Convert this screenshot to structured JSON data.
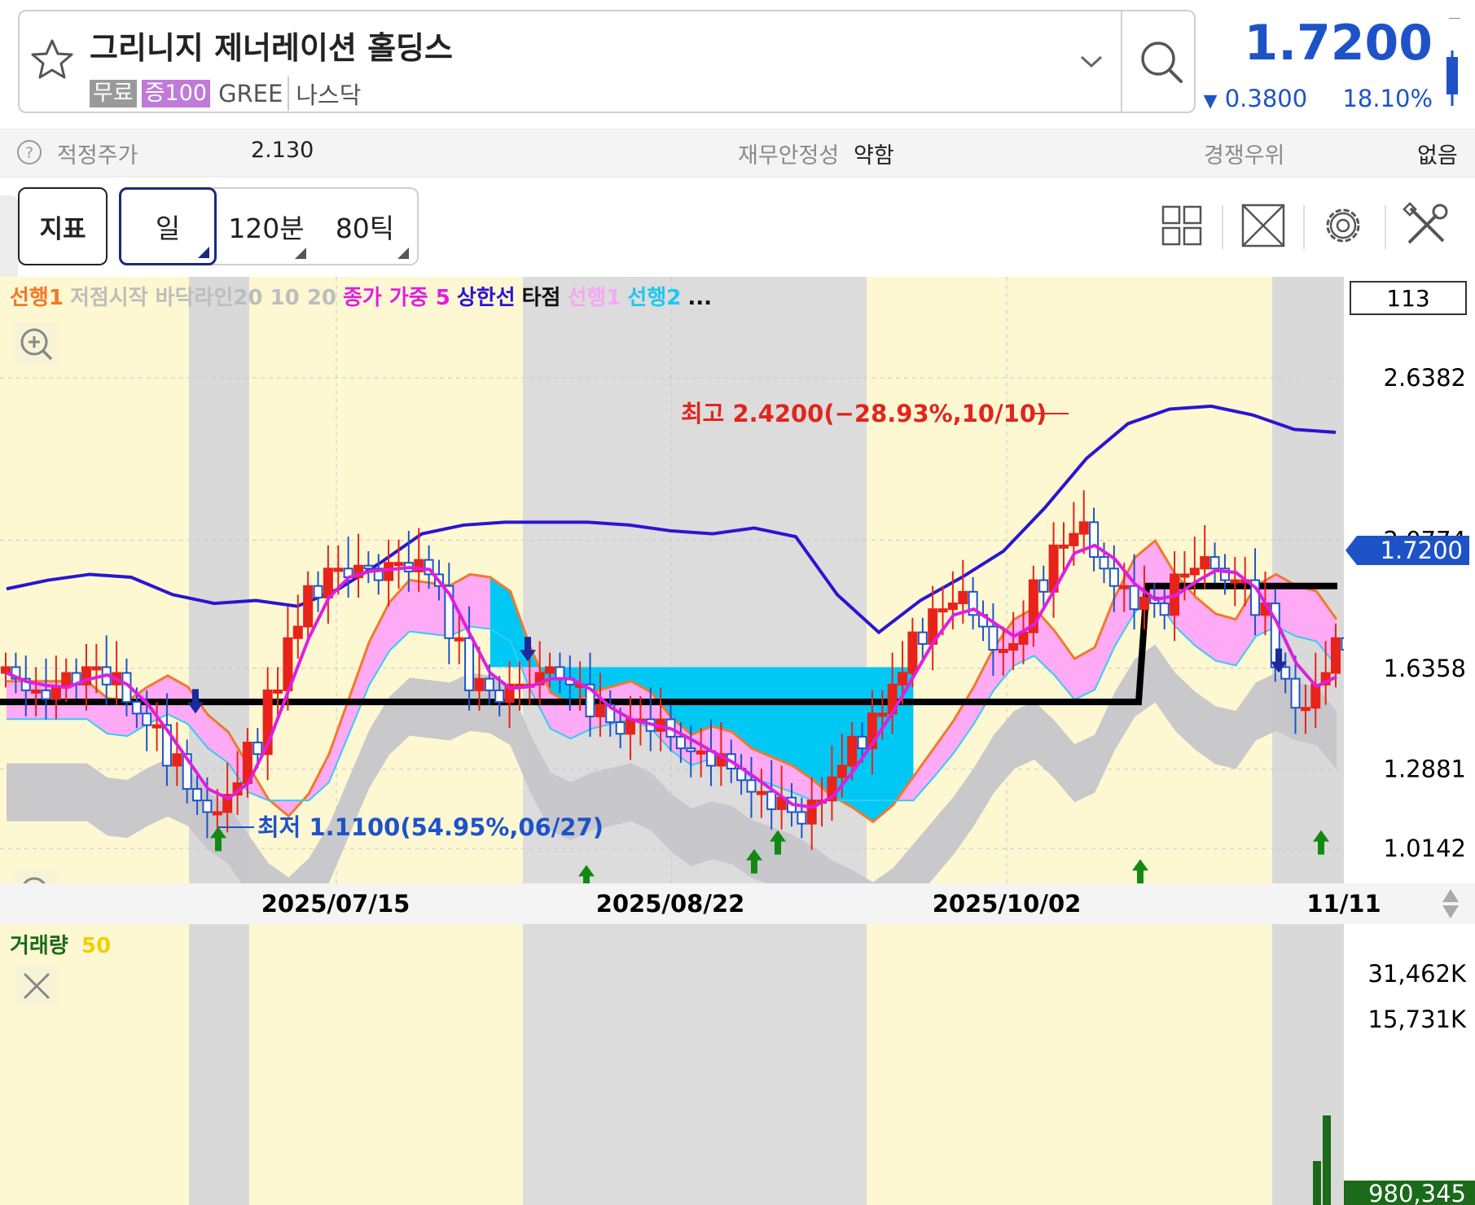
{
  "header": {
    "stock_name": "그리니지 제너레이션 홀딩스",
    "tag_free": "무료",
    "tag_margin": "증100",
    "ticker": "GREE",
    "exchange": "나스닥",
    "price": "1.7200",
    "change": "0.3800",
    "change_pct": "18.10%",
    "down_arrow": "▼"
  },
  "info": {
    "fair_label": "적정주가",
    "fair_value": "2.130",
    "stability_label": "재무안정성",
    "stability_value": "약함",
    "advantage_label": "경쟁우위",
    "advantage_value": "없음"
  },
  "toolbar": {
    "indicator": "지표",
    "periods": [
      "일",
      "120분",
      "80틱"
    ],
    "icons": [
      "grid-layout-icon",
      "expand-icon",
      "settings-gear-icon",
      "tools-icon"
    ]
  },
  "legend": [
    {
      "text": "선행1",
      "color": "#f07a2a"
    },
    {
      "text": "저점시작 바닥라인20 10 20",
      "color": "#bdbdbd"
    },
    {
      "text": "종가 가중 5",
      "color": "#e01ee0"
    },
    {
      "text": "상한선",
      "color": "#2a16d0"
    },
    {
      "text": "타점",
      "color": "#111111"
    },
    {
      "text": "선행1",
      "color": "#f5a8f5"
    },
    {
      "text": "선행2",
      "color": "#1ec8f0"
    },
    {
      "text": "...",
      "color": "#111111"
    }
  ],
  "chart_data": {
    "type": "candlestick",
    "bars_visible": "113",
    "y_ticks": [
      "2.6382",
      "2.0774",
      "1.6358",
      "1.2881",
      "1.0142"
    ],
    "ylim": [
      0.88,
      2.86
    ],
    "current_price_label": "1.7200",
    "x_ticks": [
      "2025/07/15",
      "2025/08/22",
      "2025/10/02",
      "11/11"
    ],
    "high_annotation": "최고 2.4200(−28.93%,10/10)",
    "low_annotation": "최저 1.1100(54.95%,06/27)",
    "signal_line_left": 1.52,
    "signal_line_right": 1.92,
    "close_path": [
      1.62,
      1.56,
      1.55,
      1.6,
      1.64,
      1.6,
      1.5,
      1.44,
      1.32,
      1.2,
      1.14,
      1.22,
      1.36,
      1.56,
      1.76,
      1.9,
      1.98,
      1.97,
      1.96,
      2.0,
      1.99,
      1.94,
      1.74,
      1.58,
      1.54,
      1.58,
      1.6,
      1.62,
      1.58,
      1.49,
      1.43,
      1.46,
      1.44,
      1.38,
      1.35,
      1.32,
      1.27,
      1.21,
      1.17,
      1.12,
      1.18,
      1.28,
      1.38,
      1.48,
      1.6,
      1.74,
      1.84,
      1.88,
      1.8,
      1.7,
      1.74,
      1.92,
      2.06,
      2.12,
      2.0,
      1.92,
      1.86,
      1.84,
      1.96,
      2.0,
      1.96,
      1.94,
      1.84,
      1.62,
      1.5,
      1.6,
      1.72
    ],
    "upper_band": [
      1.91,
      1.94,
      1.96,
      1.95,
      1.89,
      1.86,
      1.87,
      1.85,
      1.91,
      2.0,
      2.1,
      2.13,
      2.14,
      2.14,
      2.14,
      2.13,
      2.11,
      2.1,
      2.12,
      2.09,
      1.89,
      1.76,
      1.87,
      1.95,
      2.04,
      2.19,
      2.36,
      2.48,
      2.53,
      2.54,
      2.51,
      2.46,
      2.45
    ],
    "volume_label": "거래량",
    "volume_period": "50",
    "volume_ticks": [
      "31,462K",
      "15,731K"
    ],
    "volume_current": "980,345"
  }
}
